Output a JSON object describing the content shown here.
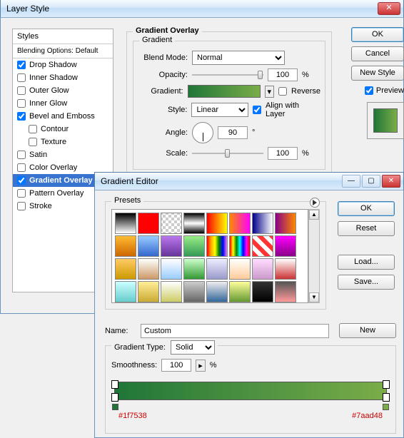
{
  "dialog1": {
    "title": "Layer Style",
    "styles_header": "Styles",
    "blending_options": "Blending Options: Default",
    "items": [
      {
        "label": "Drop Shadow",
        "checked": true
      },
      {
        "label": "Inner Shadow",
        "checked": false
      },
      {
        "label": "Outer Glow",
        "checked": false
      },
      {
        "label": "Inner Glow",
        "checked": false
      },
      {
        "label": "Bevel and Emboss",
        "checked": true
      },
      {
        "label": "Contour",
        "checked": false,
        "child": true
      },
      {
        "label": "Texture",
        "checked": false,
        "child": true
      },
      {
        "label": "Satin",
        "checked": false
      },
      {
        "label": "Color Overlay",
        "checked": false
      },
      {
        "label": "Gradient Overlay",
        "checked": true,
        "selected": true
      },
      {
        "label": "Pattern Overlay",
        "checked": false
      },
      {
        "label": "Stroke",
        "checked": false
      }
    ],
    "panel_title": "Gradient Overlay",
    "sub_title": "Gradient",
    "blend_mode_label": "Blend Mode:",
    "blend_mode": "Normal",
    "opacity_label": "Opacity:",
    "opacity": "100",
    "percent": "%",
    "gradient_label": "Gradient:",
    "reverse_label": "Reverse",
    "style_label": "Style:",
    "style": "Linear",
    "align_label": "Align with Layer",
    "angle_label": "Angle:",
    "angle": "90",
    "degree": "°",
    "scale_label": "Scale:",
    "scale": "100",
    "buttons": {
      "ok": "OK",
      "cancel": "Cancel",
      "new_style": "New Style",
      "preview": "Preview"
    },
    "gradient_colors": [
      "#1f7538",
      "#7aad48"
    ]
  },
  "dialog2": {
    "title": "Gradient Editor",
    "presets_label": "Presets",
    "name_label": "Name:",
    "name": "Custom",
    "new_btn": "New",
    "gradient_type_label": "Gradient Type:",
    "gradient_type": "Solid",
    "smoothness_label": "Smoothness:",
    "smoothness": "100",
    "percent": "%",
    "buttons": {
      "ok": "OK",
      "reset": "Reset",
      "load": "Load...",
      "save": "Save..."
    },
    "stops": {
      "left": "#1f7538",
      "right": "#7aad48"
    },
    "presets": [
      "linear-gradient(#000,#fff)",
      "#ff0000",
      "repeating-conic-gradient(#fff 0 25%,#ccc 0 50%) 50%/8px 8px",
      "linear-gradient(#000,#fff,#000)",
      "linear-gradient(90deg,#f00,#ff0)",
      "linear-gradient(90deg,#f80,#f0f)",
      "linear-gradient(90deg,#008,#fff)",
      "linear-gradient(90deg,#808,#f80)",
      "linear-gradient(#fb3,#c60)",
      "linear-gradient(#9cf,#36c)",
      "linear-gradient(#b7e,#639)",
      "linear-gradient(#9e8,#395)",
      "linear-gradient(90deg,red,orange,yellow,green,blue,violet)",
      "linear-gradient(90deg,red,yellow,green,cyan,blue,magenta,red)",
      "repeating-linear-gradient(45deg,#f33 0 6px,#fff 6px 12px)",
      "linear-gradient(#f0f,#808)",
      "linear-gradient(#fc6,#c90)",
      "linear-gradient(#fff,#c96)",
      "linear-gradient(#fff,#9cf)",
      "linear-gradient(#cfc,#393)",
      "linear-gradient(#eef,#99c)",
      "linear-gradient(#fff,#fc9)",
      "linear-gradient(#fdf,#c9c)",
      "linear-gradient(#fff,#c33)",
      "linear-gradient(#cff,#6cc)",
      "linear-gradient(#fe9,#ca3)",
      "linear-gradient(#fff,#cc6)",
      "linear-gradient(#ccc,#666)",
      "linear-gradient(#eee,#369)",
      "linear-gradient(#ff9,#693)",
      "linear-gradient(#333,#000)",
      "linear-gradient(#555,#f99)"
    ]
  }
}
